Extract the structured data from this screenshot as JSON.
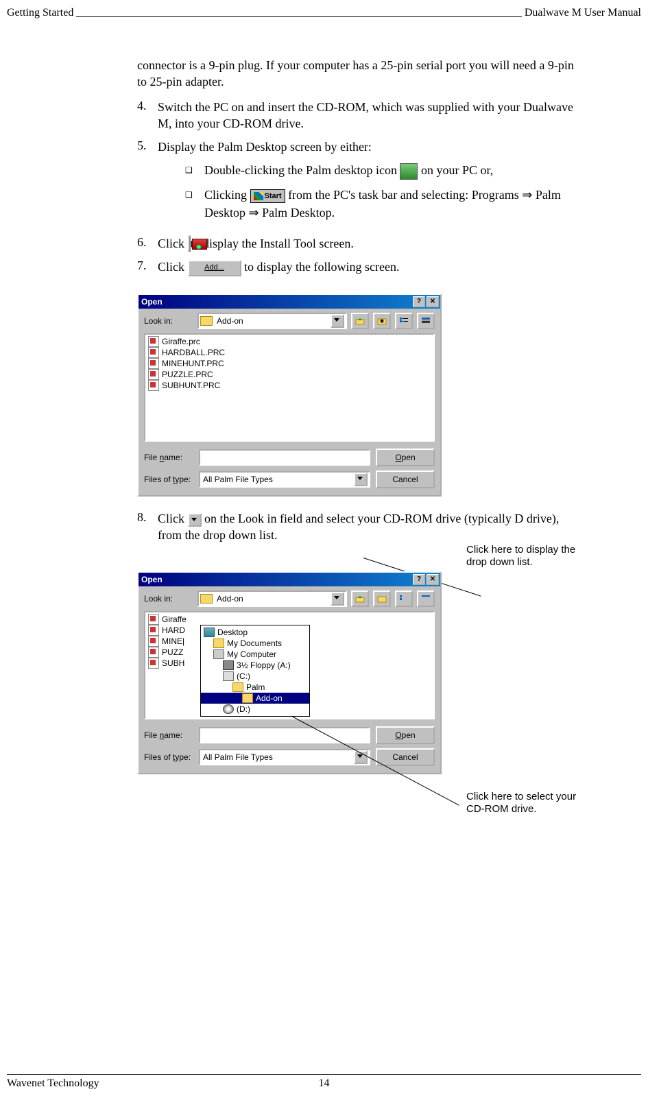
{
  "header": {
    "left": "Getting Started",
    "right": "Dualwave M User Manual"
  },
  "intro": "connector is a 9-pin plug. If your computer has a 25-pin serial port you will need a 9-pin to 25-pin adapter.",
  "steps": {
    "s4": {
      "num": "4.",
      "text": "Switch the PC on and insert the CD-ROM, which was supplied with your Dualwave M, into your CD-ROM drive."
    },
    "s5": {
      "num": "5.",
      "text": "Display the Palm Desktop screen by either:"
    },
    "s5a_pre": "Double-clicking the Palm desktop icon ",
    "s5a_post": " on your PC or,",
    "s5b_pre": "Clicking ",
    "s5b_mid": " from the PC's task bar and selecting: Programs ",
    "s5b_arrow": "⇒",
    "s5b_app1": " Palm Desktop ",
    "s5b_app2": " Palm Desktop.",
    "s6": {
      "num": "6.",
      "pre": "Click ",
      "post": " to display the Install Tool screen."
    },
    "s7": {
      "num": "7.",
      "pre": "Click ",
      "post": " to display the following screen."
    },
    "s8": {
      "num": "8.",
      "pre": "Click ",
      "post": " on the Look in field and select your CD-ROM drive (typically D drive), from the drop down list."
    }
  },
  "start_label": "Start",
  "add_label": "Add...",
  "dialog": {
    "title": "Open",
    "lookin_label": "Look in:",
    "lookin_value": "Add-on",
    "files": [
      "Giraffe.prc",
      "HARDBALL.PRC",
      "MINEHUNT.PRC",
      "PUZZLE.PRC",
      "SUBHUNT.PRC"
    ],
    "filename_label_pre": "File ",
    "filename_label_u": "n",
    "filename_label_post": "ame:",
    "filename_value": "",
    "filetype_label_pre": "Files of ",
    "filetype_label_u": "t",
    "filetype_label_post": "ype:",
    "filetype_value": "All Palm File Types",
    "open_u": "O",
    "open_rest": "pen",
    "cancel": "Cancel"
  },
  "dialog2_files_trunc": [
    "Giraffe",
    "HARD",
    "MINE|",
    "PUZZ",
    "SUBH"
  ],
  "tree": {
    "desktop": "Desktop",
    "mydocs": "My Documents",
    "mycomp": "My Computer",
    "floppy": "3½ Floppy (A:)",
    "c": "(C:)",
    "palm": "Palm",
    "addon": "Add-on",
    "d": "(D:)"
  },
  "callouts": {
    "top": "Click here to display the drop down list.",
    "bottom": "Click here to select your CD-ROM drive."
  },
  "footer": {
    "company": "Wavenet Technology",
    "page": "14"
  }
}
